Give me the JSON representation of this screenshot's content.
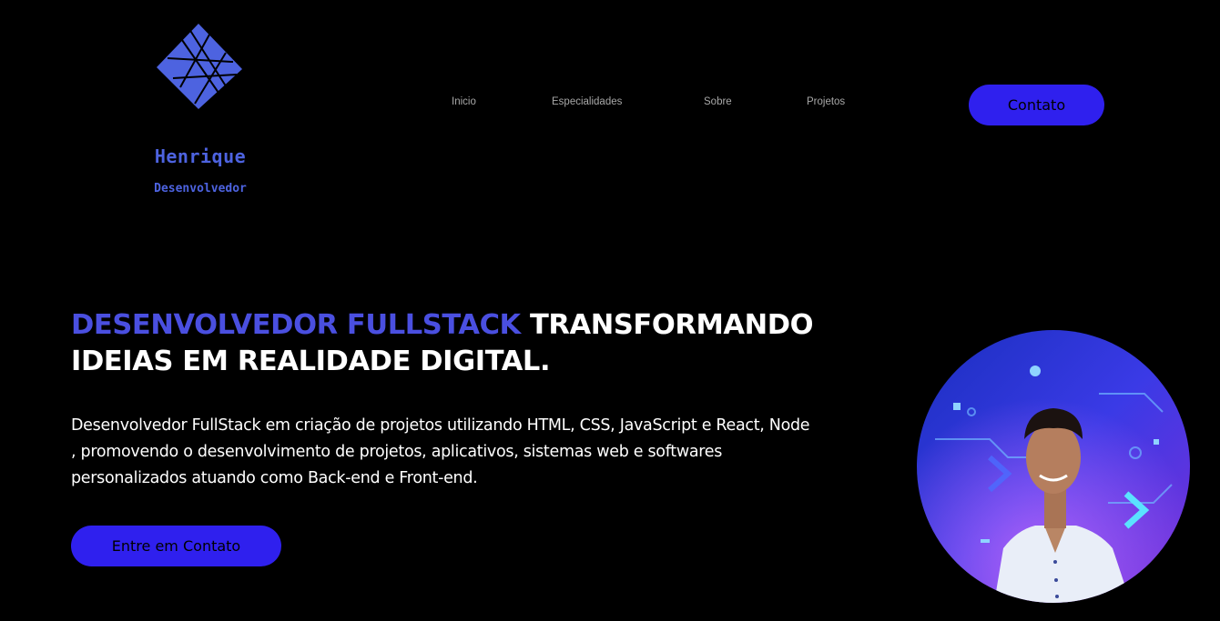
{
  "logo": {
    "name": "Henrique",
    "role": "Desenvolvedor",
    "icon": "diamond-grid-logo",
    "color": "#4d63e0"
  },
  "nav": {
    "items": [
      {
        "label": "Inicio"
      },
      {
        "label": "Especialidades"
      },
      {
        "label": "Sobre"
      },
      {
        "label": "Projetos"
      }
    ],
    "contact_label": "Contato"
  },
  "hero": {
    "title_accent": "DESENVOLVEDOR FULLSTACK",
    "title_rest": " TRANSFORMANDO IDEIAS EM REALIDADE DIGITAL.",
    "description": "Desenvolvedor FullStack em criação de projetos utilizando HTML, CSS, JavaScript e React, Node , promovendo o desenvolvimento de projetos, aplicativos, sistemas web e softwares personalizados atuando como Back-end e Front-end.",
    "cta_label": "Entre em Contato"
  },
  "colors": {
    "background": "#000000",
    "accent": "#4a4fe0",
    "button": "#2f20ee",
    "nav_text": "#a8a8a8"
  }
}
